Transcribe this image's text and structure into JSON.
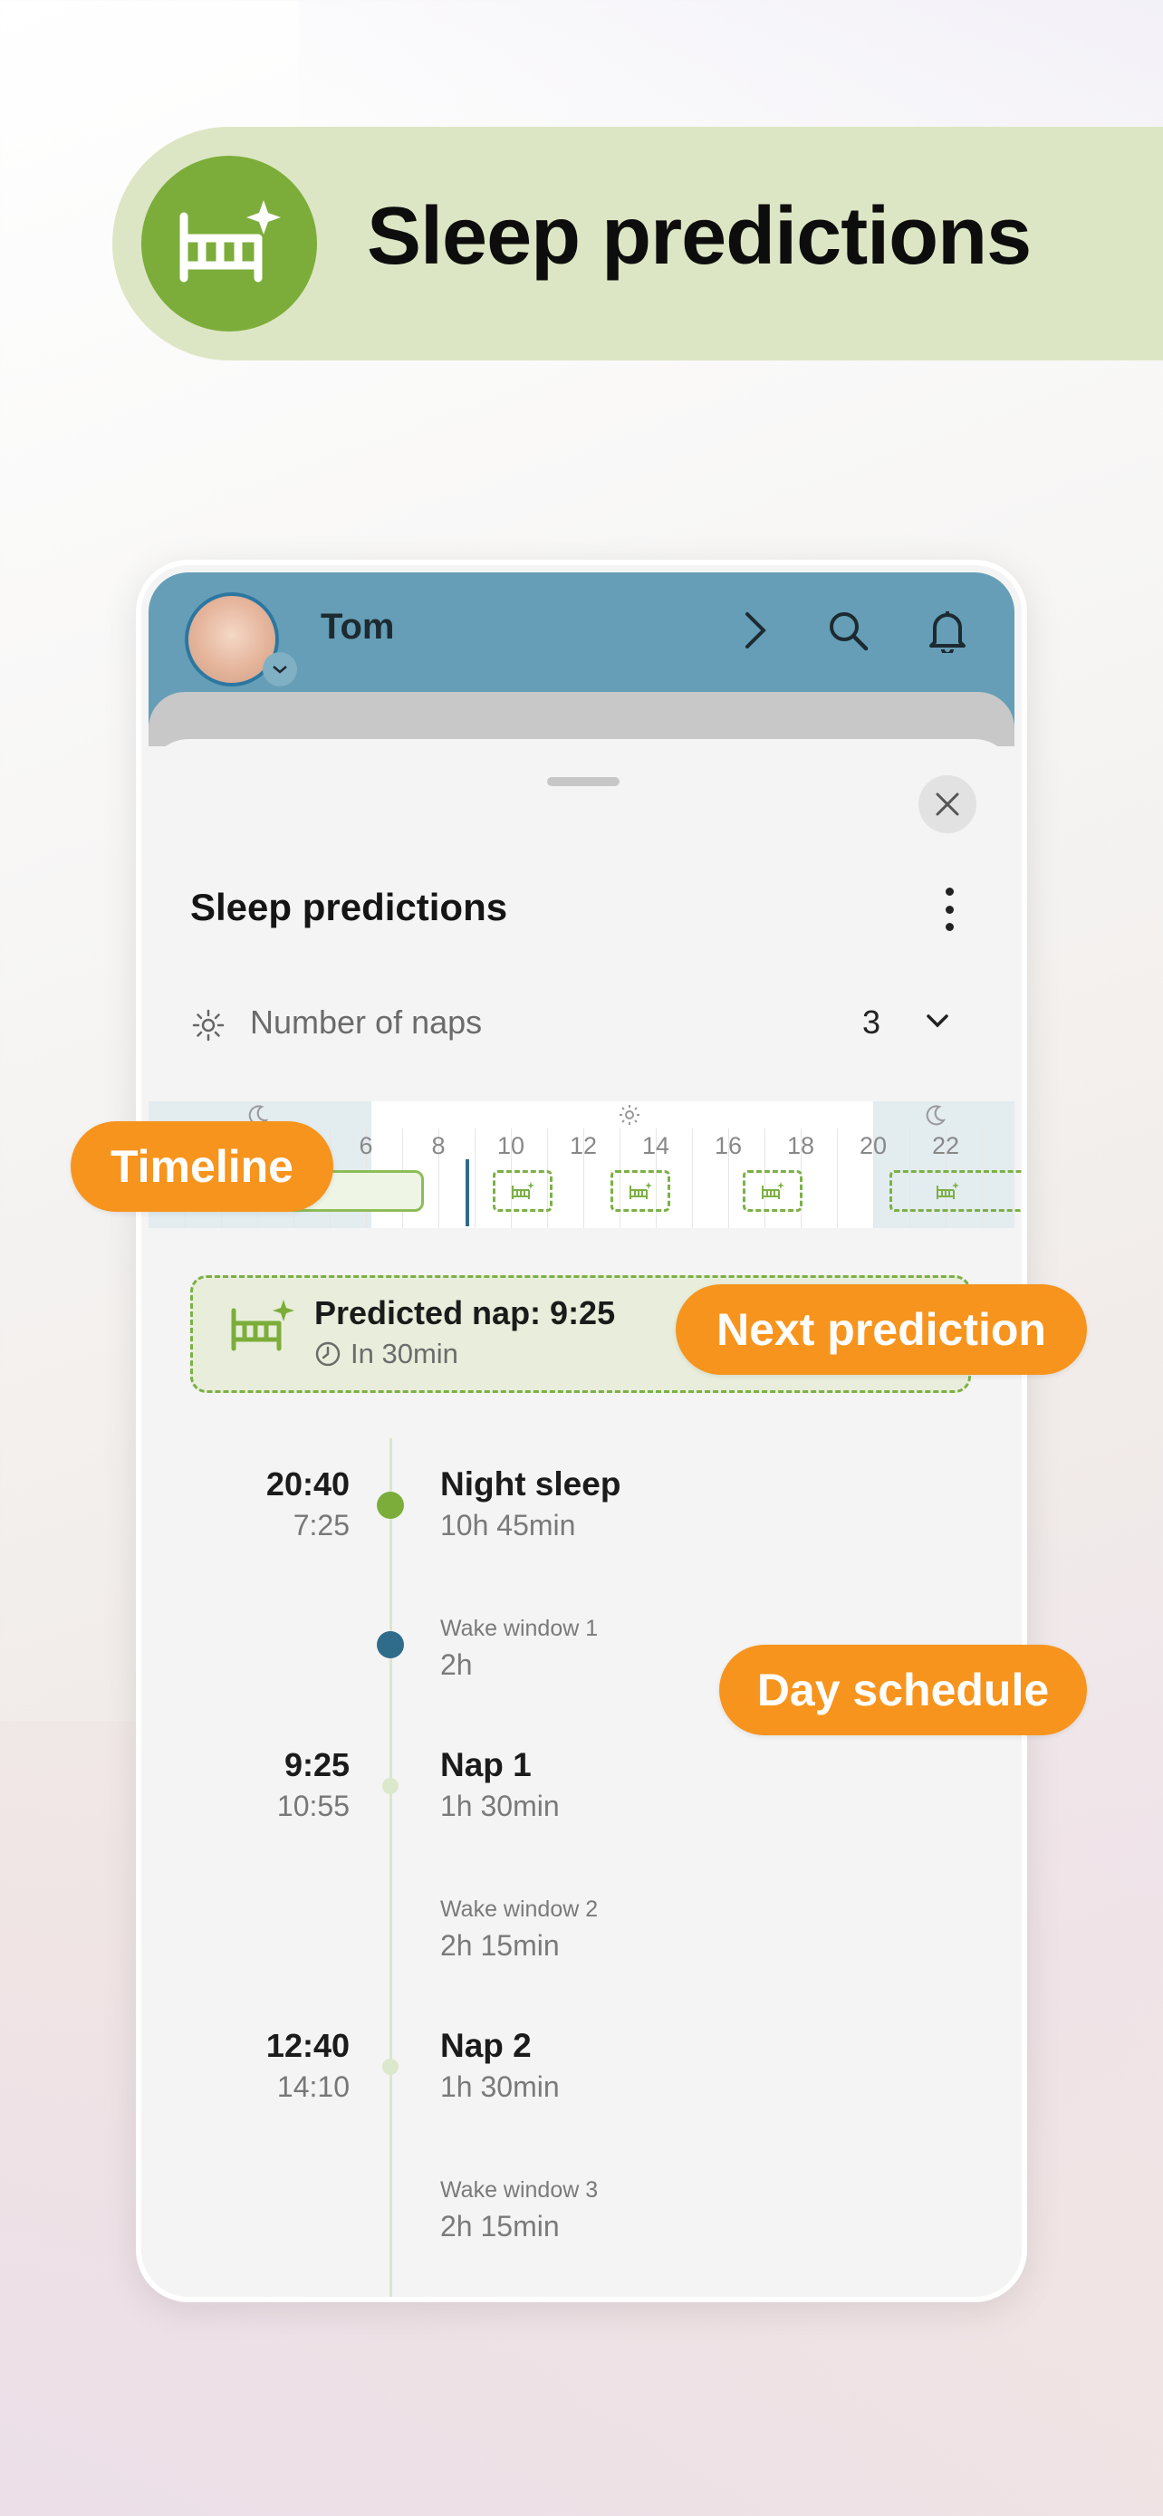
{
  "banner": {
    "title": "Sleep predictions",
    "icon": "crib-sparkle-icon"
  },
  "app": {
    "child_name": "Tom",
    "sheet_title": "Sleep predictions",
    "naps": {
      "label": "Number of naps",
      "value": "3"
    },
    "timeline": {
      "ticks": [
        "6",
        "8",
        "10",
        "12",
        "14",
        "16",
        "18",
        "20",
        "22"
      ]
    },
    "prediction": {
      "title": "Predicted nap: 9:25",
      "subtitle": "In 30min"
    },
    "schedule": [
      {
        "kind": "event",
        "start": "20:40",
        "end": "7:25",
        "title": "Night sleep",
        "duration": "10h 45min"
      },
      {
        "kind": "wake",
        "title": "Wake window 1",
        "duration": "2h"
      },
      {
        "kind": "event",
        "start": "9:25",
        "end": "10:55",
        "title": "Nap 1",
        "duration": "1h 30min"
      },
      {
        "kind": "wake",
        "title": "Wake window 2",
        "duration": "2h 15min"
      },
      {
        "kind": "event",
        "start": "12:40",
        "end": "14:10",
        "title": "Nap 2",
        "duration": "1h 30min"
      },
      {
        "kind": "wake",
        "title": "Wake window 3",
        "duration": "2h 15min"
      }
    ]
  },
  "callouts": {
    "timeline": "Timeline",
    "next_prediction": "Next prediction",
    "day_schedule": "Day schedule"
  },
  "colors": {
    "green": "#7cad3a",
    "orange": "#f7941d",
    "appbar": "#659eb6",
    "wake_dot": "#2f6c8c"
  }
}
